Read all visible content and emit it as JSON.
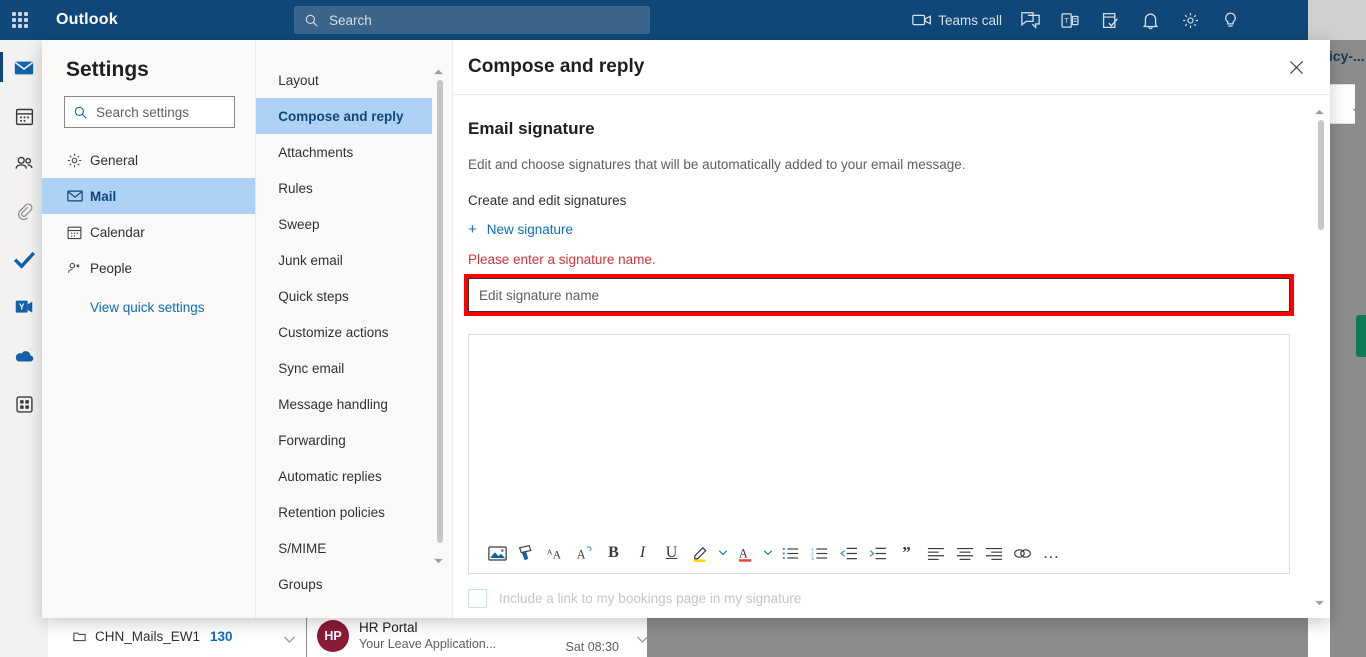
{
  "header": {
    "waffle_label": "App launcher",
    "brand": "Outlook",
    "search_placeholder": "Search",
    "teams_call_label": "Teams call",
    "icons": [
      {
        "name": "video-camera-icon",
        "label": "Teams call"
      },
      {
        "name": "chat-icon",
        "label": "Chat"
      },
      {
        "name": "teams-icon",
        "label": "Teams"
      },
      {
        "name": "my-day-icon",
        "label": "My Day"
      },
      {
        "name": "bell-icon",
        "label": "Notifications"
      },
      {
        "name": "gear-icon",
        "label": "Settings"
      },
      {
        "name": "lightbulb-icon",
        "label": "Tips"
      }
    ]
  },
  "app_rail": [
    {
      "name": "mail-icon",
      "label": "Mail",
      "active": true
    },
    {
      "name": "calendar-icon",
      "label": "Calendar",
      "active": false
    },
    {
      "name": "people-icon",
      "label": "People",
      "active": false
    },
    {
      "name": "files-icon",
      "label": "Files",
      "active": false
    },
    {
      "name": "to-do-icon",
      "label": "To Do",
      "active": false
    },
    {
      "name": "yammer-icon",
      "label": "Yammer",
      "active": false
    },
    {
      "name": "onedrive-icon",
      "label": "OneDrive",
      "active": false
    },
    {
      "name": "apps-icon",
      "label": "All apps",
      "active": false
    }
  ],
  "background": {
    "folder_name": "CHN_Mails_EW1",
    "folder_count": "130",
    "message_sender": "HR Portal",
    "message_subject": "Your Leave Application...",
    "message_time": "Sat 08:30",
    "avatar_initials": "HP",
    "subject_fragment": "licy-..."
  },
  "settings": {
    "title": "Settings",
    "search_placeholder": "Search settings",
    "items": [
      {
        "label": "General",
        "icon": "gear-icon",
        "active": false
      },
      {
        "label": "Mail",
        "icon": "mail-icon",
        "active": true
      },
      {
        "label": "Calendar",
        "icon": "calendar-icon",
        "active": false
      },
      {
        "label": "People",
        "icon": "people-icon",
        "active": false
      }
    ],
    "quick_settings_link": "View quick settings"
  },
  "mail_subnav": {
    "items": [
      {
        "label": "Layout",
        "active": false
      },
      {
        "label": "Compose and reply",
        "active": true
      },
      {
        "label": "Attachments",
        "active": false
      },
      {
        "label": "Rules",
        "active": false
      },
      {
        "label": "Sweep",
        "active": false
      },
      {
        "label": "Junk email",
        "active": false
      },
      {
        "label": "Quick steps",
        "active": false
      },
      {
        "label": "Customize actions",
        "active": false
      },
      {
        "label": "Sync email",
        "active": false
      },
      {
        "label": "Message handling",
        "active": false
      },
      {
        "label": "Forwarding",
        "active": false
      },
      {
        "label": "Automatic replies",
        "active": false
      },
      {
        "label": "Retention policies",
        "active": false
      },
      {
        "label": "S/MIME",
        "active": false
      },
      {
        "label": "Groups",
        "active": false
      }
    ]
  },
  "detail": {
    "title": "Compose and reply",
    "close_label": "Close",
    "signature_heading": "Email signature",
    "signature_description": "Edit and choose signatures that will be automatically added to your email message.",
    "create_edit_label": "Create and edit signatures",
    "new_signature_label": "New signature",
    "error_message": "Please enter a signature name.",
    "signature_name_value": "",
    "signature_name_placeholder": "Edit signature name",
    "bookings_label": "Include a link to my bookings page in my signature",
    "toolbar": [
      {
        "name": "insert-picture-icon",
        "label": "Insert picture"
      },
      {
        "name": "format-painter-icon",
        "label": "Format painter"
      },
      {
        "name": "font-size-icon",
        "label": "Font size"
      },
      {
        "name": "clear-formatting-icon",
        "label": "Clear formatting"
      },
      {
        "name": "bold-icon",
        "label": "Bold"
      },
      {
        "name": "italic-icon",
        "label": "Italic"
      },
      {
        "name": "underline-icon",
        "label": "Underline"
      },
      {
        "name": "highlight-color-icon",
        "label": "Highlight"
      },
      {
        "name": "font-color-icon",
        "label": "Font color"
      },
      {
        "name": "bulleted-list-icon",
        "label": "Bulleted list"
      },
      {
        "name": "numbered-list-icon",
        "label": "Numbered list"
      },
      {
        "name": "decrease-indent-icon",
        "label": "Decrease indent"
      },
      {
        "name": "increase-indent-icon",
        "label": "Increase indent"
      },
      {
        "name": "quote-icon",
        "label": "Quote"
      },
      {
        "name": "align-left-icon",
        "label": "Align left"
      },
      {
        "name": "align-center-icon",
        "label": "Align center"
      },
      {
        "name": "align-right-icon",
        "label": "Align right"
      },
      {
        "name": "insert-link-icon",
        "label": "Insert link"
      },
      {
        "name": "more-options-icon",
        "label": "More options"
      }
    ]
  },
  "colors": {
    "header_blue": "#0f4878",
    "accent_blue": "#0f6cbd",
    "selection_blue": "#aed2f5",
    "error_red": "#d13438",
    "annotation_red": "#ff0000",
    "highlight_yellow": "#ffd400",
    "font_color_red": "#e8443a"
  }
}
